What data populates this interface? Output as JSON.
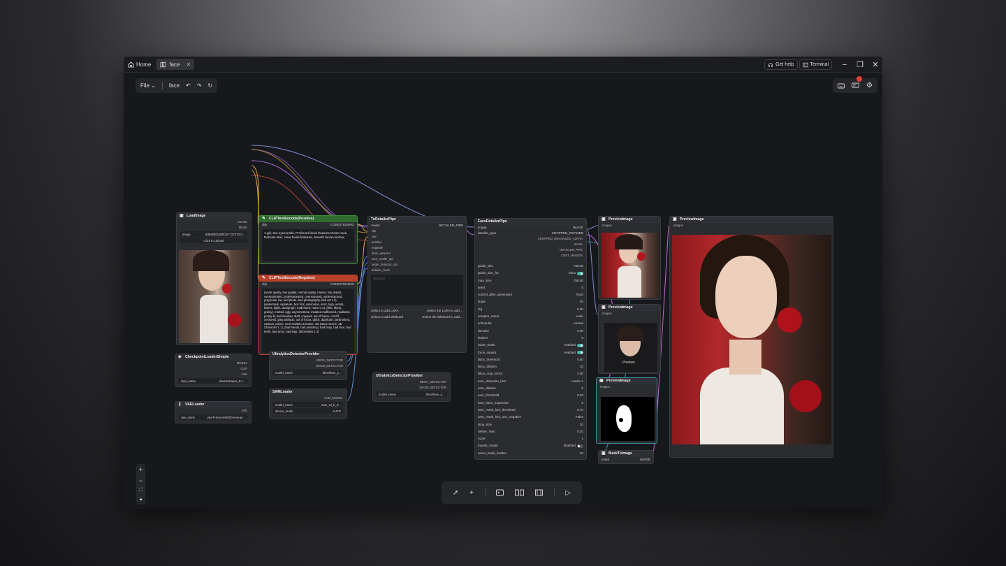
{
  "titlebar": {
    "home_label": "Home",
    "tab_label": "face",
    "help_label": "Get help",
    "terminal_label": "Terminal"
  },
  "menubar": {
    "file_label": "File",
    "workflow_name": "face"
  },
  "nodes": {
    "load_image": {
      "title": "LoadImage",
      "outputs": [
        "IMAGE",
        "MASK"
      ],
      "image_key": "image",
      "image_value": "dd6d6fbf1dd0f2e7737372c3...",
      "upload_label": "Click to Upload"
    },
    "clip_pos": {
      "title": "CLIPTextEncode(Positive)",
      "in": "clip",
      "out": "CONDITIONING",
      "text": "1 girl,  two eyes,smile,   Profound facial features,Clean neck, Delicate skin, clear facial features, smooth facial contour,"
    },
    "clip_neg": {
      "title": "CLIPTextEncode(Negative)",
      "in": "clip",
      "out": "CONDITIONING",
      "text": "(worst quality, low quality, normal quality, lowres, low details, oversaturated, undersaturated, overexposed, underexposed, grayscale, bw, bad photo, bad photography, bad art:1.4), (watermark, signature, text font, username, error, logo, words, letters, digits, autograph, trademark, name:1.2), (blur, blurry, grainy), morbid, ugly, asymmetrical, mutated malformed, mutilated, poorly lit, bad shadow, draft, cropped, out of frame, cut off, censored, jpeg artifacts, out of focus, glitch, duplicate, (airbrushed, cartoon, anime, semi-realistic:1)Game, 3D Game Scene, 3D Character:1.1), (bad hands, bad anatomy,) bad body, bad face, bad teeth, bad arms, bad legs, deformities:1.3)"
    },
    "checkpoint": {
      "title": "CheckpointLoaderSimple",
      "outputs": [
        "MODEL",
        "CLIP",
        "VAE"
      ],
      "key": "ckpt_name",
      "value": "dreamshaper_8.s..."
    },
    "vae": {
      "title": "VAELoader",
      "output": "VAE",
      "key": "vae_name",
      "value": "vae-ft-mse-840000-ema-pr..."
    },
    "ultra1": {
      "title": "UltralyticsDetectorProvider",
      "outputs": [
        "BBOX_DETECTOR",
        "SEGM_DETECTOR"
      ],
      "key": "model_name",
      "value": "bbox/face_y..."
    },
    "sam": {
      "title": "SAMLoader",
      "output": "SAM_MODEL",
      "rows": [
        {
          "k": "model_name",
          "v": "sam_vit_b_0..."
        },
        {
          "k": "device_mode",
          "v": "AUTO"
        }
      ]
    },
    "to_detailer": {
      "title": "ToDetailerPipe",
      "out": "DETAILER_PIPE",
      "inputs": [
        "model",
        "clip",
        "vae",
        "positive",
        "negative",
        "bbox_detector",
        "sam_model_opt",
        "segm_detector_opt",
        "detailer_hook"
      ],
      "wildcard": "wildcard",
      "lora_label": "Select to add LoRA",
      "lora_value": "Select the LoRA to add ...",
      "wild_label": "Select to add Wildcard",
      "wild_value": "Select the Wildcard to add ..."
    },
    "ultra2": {
      "title": "UltralyticsDetectorProvider",
      "outputs": [
        "BBOX_DETECTOR",
        "SEGM_DETECTOR"
      ],
      "key": "model_name",
      "value": "bbox/face_y..."
    },
    "face_detailer": {
      "title": "FaceDetailerPipe",
      "inputs": [
        "image",
        "detailer_pipe"
      ],
      "outputs": [
        "IMAGE",
        "CROPPED_REFINED",
        "CROPPED_ENHANCED_ALPHA",
        "MASK",
        "DETAILER_PIPE",
        "CNET_IMAGES"
      ],
      "rows": [
        {
          "k": "guide_size",
          "v": "768.00"
        },
        {
          "k": "guide_size_for",
          "v": "bbox",
          "toggle": "on"
        },
        {
          "k": "max_size",
          "v": "768.00"
        },
        {
          "k": "seed",
          "v": "0"
        },
        {
          "k": "control_after_generated",
          "v": "fixed"
        },
        {
          "k": "steps",
          "v": "30"
        },
        {
          "k": "cfg",
          "v": "8.00"
        },
        {
          "k": "sampler_name",
          "v": "euler"
        },
        {
          "k": "scheduler",
          "v": "normal"
        },
        {
          "k": "denoise",
          "v": "0.50"
        },
        {
          "k": "feather",
          "v": "5"
        },
        {
          "k": "noise_mask",
          "v": "enabled",
          "toggle": "on"
        },
        {
          "k": "force_inpaint",
          "v": "enabled",
          "toggle": "on"
        },
        {
          "k": "bbox_threshold",
          "v": "0.50"
        },
        {
          "k": "bbox_dilation",
          "v": "10"
        },
        {
          "k": "bbox_crop_factor",
          "v": "3.00"
        },
        {
          "k": "sam_detection_hint",
          "v": "center-1"
        },
        {
          "k": "sam_dilation",
          "v": "0"
        },
        {
          "k": "sam_threshold",
          "v": "0.93"
        },
        {
          "k": "sam_bbox_expansion",
          "v": "0"
        },
        {
          "k": "sam_mask_hint_threshold",
          "v": "0.70"
        },
        {
          "k": "sam_mask_hint_use_negative",
          "v": "False"
        },
        {
          "k": "drop_size",
          "v": "10"
        },
        {
          "k": "refiner_ratio",
          "v": "0.20"
        },
        {
          "k": "cycle",
          "v": "1"
        },
        {
          "k": "inpaint_model",
          "v": "disabled",
          "toggle": "off"
        },
        {
          "k": "noise_mask_feather",
          "v": "20"
        }
      ]
    },
    "preview1": {
      "title": "PreviewImage",
      "in": "images"
    },
    "preview2": {
      "title": "PreviewImage",
      "in": "images",
      "overlay": "Preview"
    },
    "preview3": {
      "title": "PreviewImage",
      "in": "images"
    },
    "mask_to_image": {
      "title": "MaskToImage",
      "in": "mask",
      "out": "IMAGE"
    },
    "preview_big": {
      "title": "PreviewImage",
      "in": "images"
    }
  },
  "colors": {
    "positive_header": "#2f6b2f",
    "negative_header": "#b8412c",
    "selected_border": "#3c8fa8",
    "toggle_on": "#3bb8a5",
    "notification": "#e0413c"
  },
  "icons": [
    "home-icon",
    "map-icon",
    "close-icon",
    "headset-icon",
    "terminal-icon",
    "minimize-icon",
    "restore-icon",
    "window-close-icon",
    "chevron-down-icon",
    "undo-icon",
    "redo-icon",
    "refresh-icon",
    "keyboard-icon",
    "queue-icon",
    "gear-icon",
    "zoom-in-icon",
    "zoom-out-icon",
    "fit-view-icon",
    "lock-icon",
    "pointer-icon",
    "plus-icon",
    "console-icon",
    "nodes-icon",
    "film-icon",
    "run-icon"
  ]
}
